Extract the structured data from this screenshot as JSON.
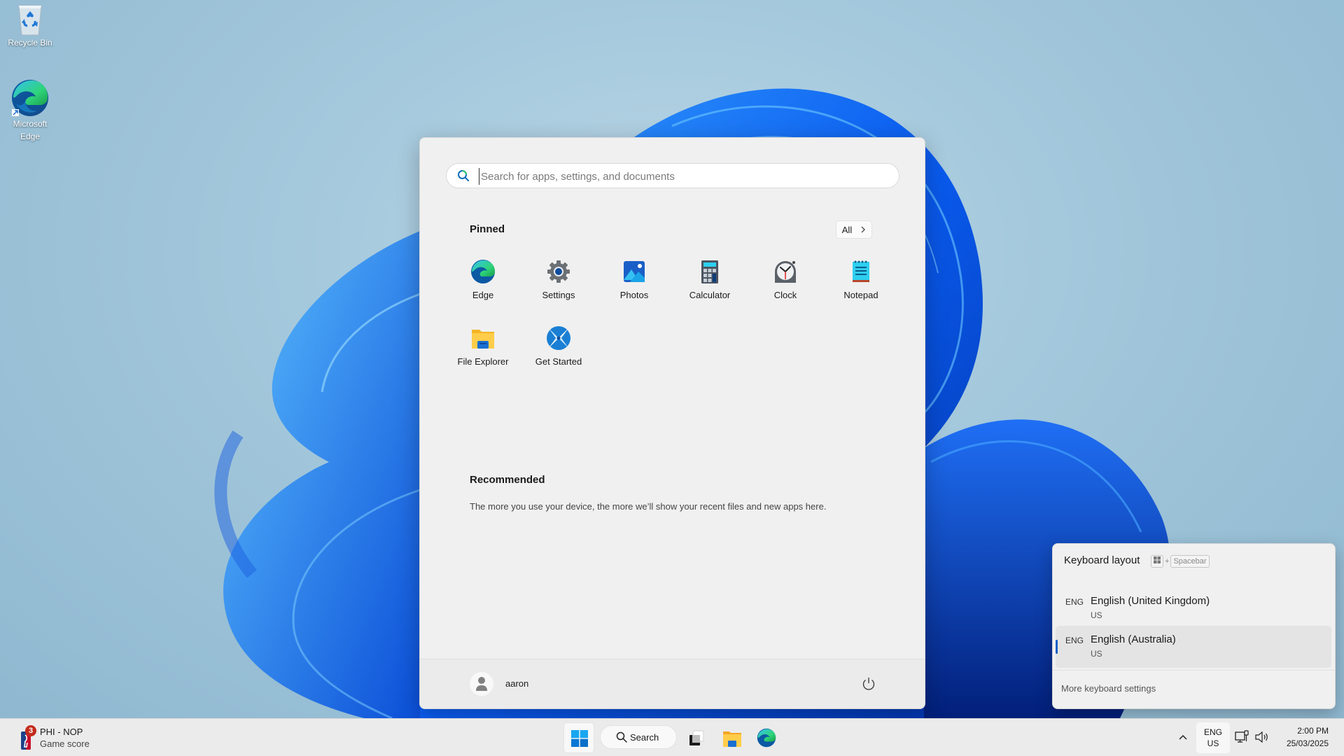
{
  "desktop": {
    "icons": [
      {
        "label": "Recycle Bin"
      },
      {
        "label_line1": "Microsoft",
        "label_line2": "Edge"
      }
    ]
  },
  "start_menu": {
    "search": {
      "placeholder": "Search for apps, settings, and documents",
      "value": ""
    },
    "pinned": {
      "title": "Pinned",
      "all_button": "All",
      "apps": [
        {
          "label": "Edge",
          "icon": "edge-icon"
        },
        {
          "label": "Settings",
          "icon": "gear-icon"
        },
        {
          "label": "Photos",
          "icon": "photos-icon"
        },
        {
          "label": "Calculator",
          "icon": "calculator-icon"
        },
        {
          "label": "Clock",
          "icon": "clock-icon"
        },
        {
          "label": "Notepad",
          "icon": "notepad-icon"
        },
        {
          "label": "File Explorer",
          "icon": "folder-icon"
        },
        {
          "label": "Get Started",
          "icon": "get-started-icon"
        }
      ]
    },
    "recommended": {
      "title": "Recommended",
      "empty_text": "The more you use your device, the more we’ll show your recent files and new apps here."
    },
    "footer": {
      "user_name": "aaron"
    }
  },
  "keyboard_flyout": {
    "title": "Keyboard layout",
    "shortcut_plus": "+",
    "shortcut_key": "Spacebar",
    "languages": [
      {
        "code": "ENG",
        "name": "English (United Kingdom)",
        "layout": "US",
        "selected": false
      },
      {
        "code": "ENG",
        "name": "English (Australia)",
        "layout": "US",
        "selected": true
      }
    ],
    "more_link": "More keyboard settings",
    "accent_color": "#0a5fc6"
  },
  "taskbar": {
    "widget": {
      "badge_count": "3",
      "line1": "PHI - NOP",
      "line2": "Game score"
    },
    "search_label": "Search",
    "tray": {
      "lang_line1": "ENG",
      "lang_line2": "US",
      "time": "2:00 PM",
      "date": "25/03/2025"
    }
  }
}
